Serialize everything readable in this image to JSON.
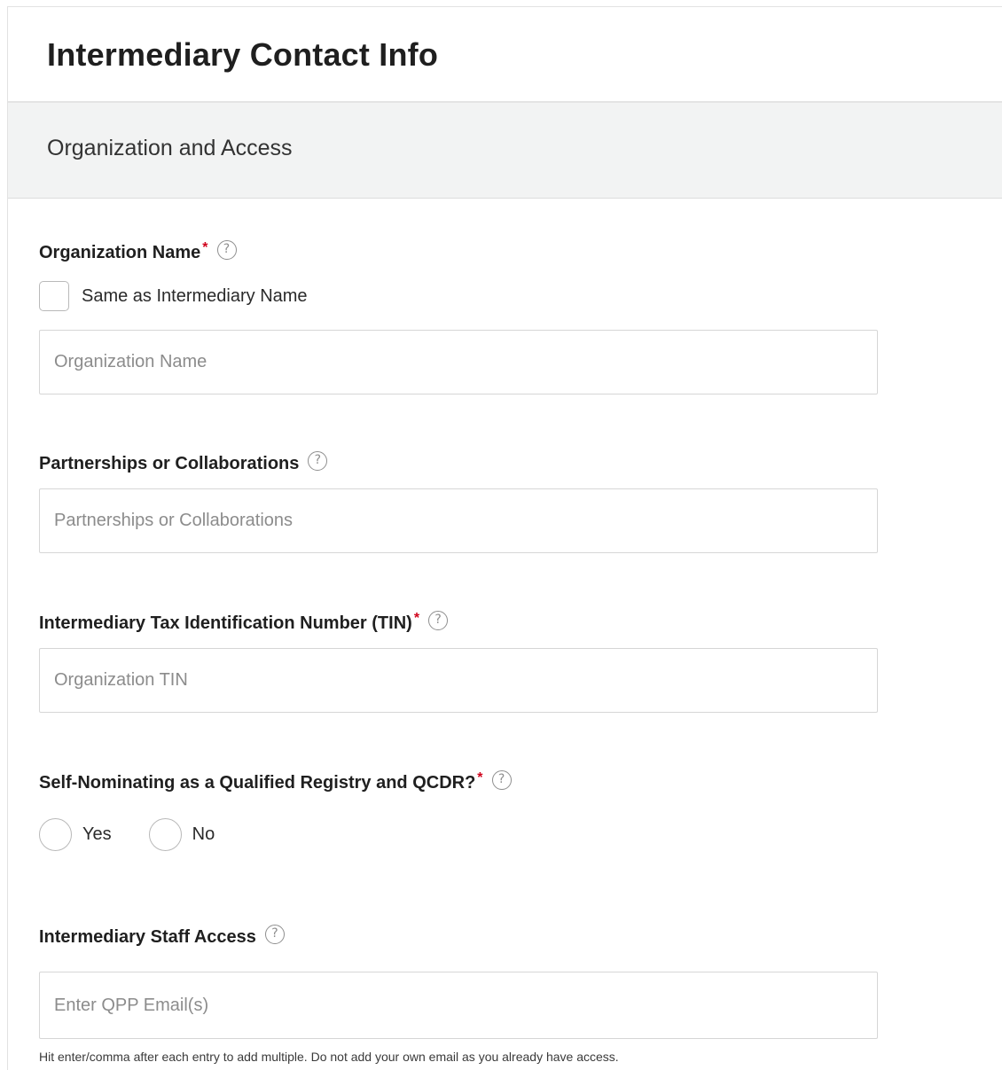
{
  "header": {
    "title": "Intermediary Contact Info"
  },
  "section": {
    "title": "Organization and Access"
  },
  "fields": {
    "organization_name": {
      "label": "Organization Name",
      "required_mark": "*",
      "checkbox_label": "Same as Intermediary Name",
      "checkbox_checked": false,
      "placeholder": "Organization Name",
      "value": ""
    },
    "partnerships": {
      "label": "Partnerships or Collaborations",
      "placeholder": "Partnerships or Collaborations",
      "value": ""
    },
    "tin": {
      "label": "Intermediary Tax Identification Number (TIN)",
      "required_mark": "*",
      "placeholder": "Organization TIN",
      "value": ""
    },
    "self_nominating": {
      "label": "Self-Nominating as a Qualified Registry and QCDR?",
      "required_mark": "*",
      "options": [
        {
          "label": "Yes",
          "selected": false
        },
        {
          "label": "No",
          "selected": false
        }
      ]
    },
    "staff_access": {
      "label": "Intermediary Staff Access",
      "placeholder": "Enter QPP Email(s)",
      "value": "",
      "hint": "Hit enter/comma after each entry to add multiple. Do not add your own email as you already have access."
    }
  },
  "icons": {
    "help": "?"
  },
  "colors": {
    "required": "#d0021b",
    "section_bg": "#f2f3f3",
    "border": "#d6d6d6"
  }
}
